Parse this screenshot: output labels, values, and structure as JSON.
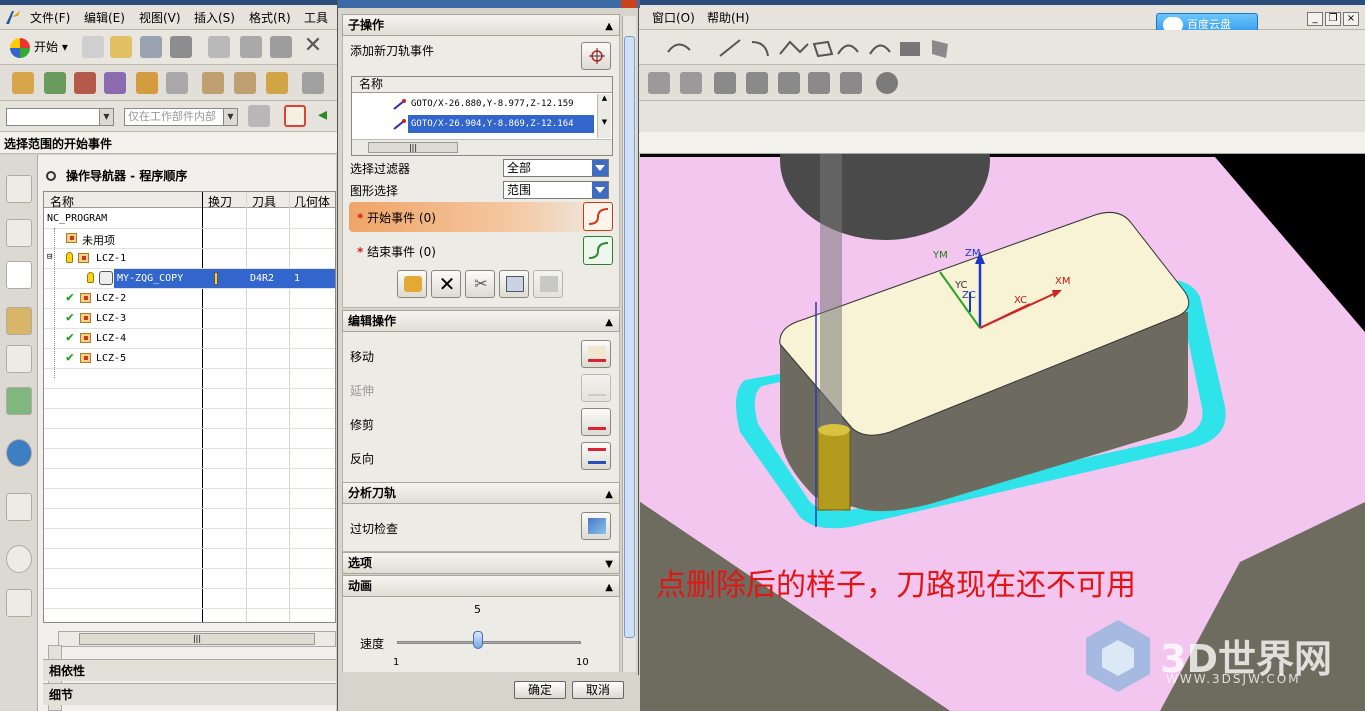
{
  "menubar": {
    "items": [
      "文件(F)",
      "编辑(E)",
      "视图(V)",
      "插入(S)",
      "格式(R)",
      "工具",
      "窗口(O)",
      "帮助(H)"
    ],
    "cloud_button": "百度云盘"
  },
  "toolbar": {
    "start_label": "开始",
    "filter_combo": "",
    "scope_combo": "仅在工作部件内部"
  },
  "select_bar": {
    "label": "选择范围的开始事件"
  },
  "navigator": {
    "title": "操作导航器 - 程序顺序",
    "columns": [
      "名称",
      "换刀",
      "刀具",
      "几何体"
    ],
    "rows": [
      {
        "name": "NC_PROGRAM",
        "tool": "",
        "geom": ""
      },
      {
        "name": "未用项",
        "tool": "",
        "geom": ""
      },
      {
        "name": "LCZ-1",
        "tool": "",
        "geom": ""
      },
      {
        "name": "MY-ZQG_COPY",
        "tool": "D4R2",
        "geom": "1"
      },
      {
        "name": "LCZ-2",
        "tool": "",
        "geom": ""
      },
      {
        "name": "LCZ-3",
        "tool": "",
        "geom": ""
      },
      {
        "name": "LCZ-4",
        "tool": "",
        "geom": ""
      },
      {
        "name": "LCZ-5",
        "tool": "",
        "geom": ""
      }
    ],
    "dependency_label": "相依性",
    "detail_label": "细节"
  },
  "dialog": {
    "sub_ops": {
      "header": "子操作",
      "add_event": "添加新刀轨事件",
      "list_header": "名称",
      "list_rows": [
        "GOTO/X-26.880,Y-8.977,Z-12.159",
        "GOTO/X-26.904,Y-8.869,Z-12.164"
      ],
      "filter_label": "选择过滤器",
      "filter_value": "全部",
      "shape_label": "图形选择",
      "shape_value": "范围",
      "start_event": "开始事件 (0)",
      "end_event": "结束事件 (0)"
    },
    "edit_ops": {
      "header": "编辑操作",
      "move": "移动",
      "extend": "延伸",
      "trim": "修剪",
      "reverse": "反向"
    },
    "analysis": {
      "header": "分析刀轨",
      "gouge_check": "过切检查"
    },
    "options": {
      "header": "选项"
    },
    "animation": {
      "header": "动画",
      "speed_label": "速度",
      "speed_value": "5",
      "speed_min": "1",
      "speed_max": "10",
      "speed_fraction": 0.44
    },
    "ok_label": "确定",
    "cancel_label": "取消"
  },
  "graphics": {
    "axes": {
      "ym": "YM",
      "zm": "ZM",
      "xm": "XM",
      "yc": "YC",
      "zc": "ZC",
      "xc": "XC"
    },
    "annotation": "点删除后的样子，刀路现在还不可用",
    "watermark": "3D世界网",
    "watermark_url": "WWW.3DSJW.COM"
  }
}
